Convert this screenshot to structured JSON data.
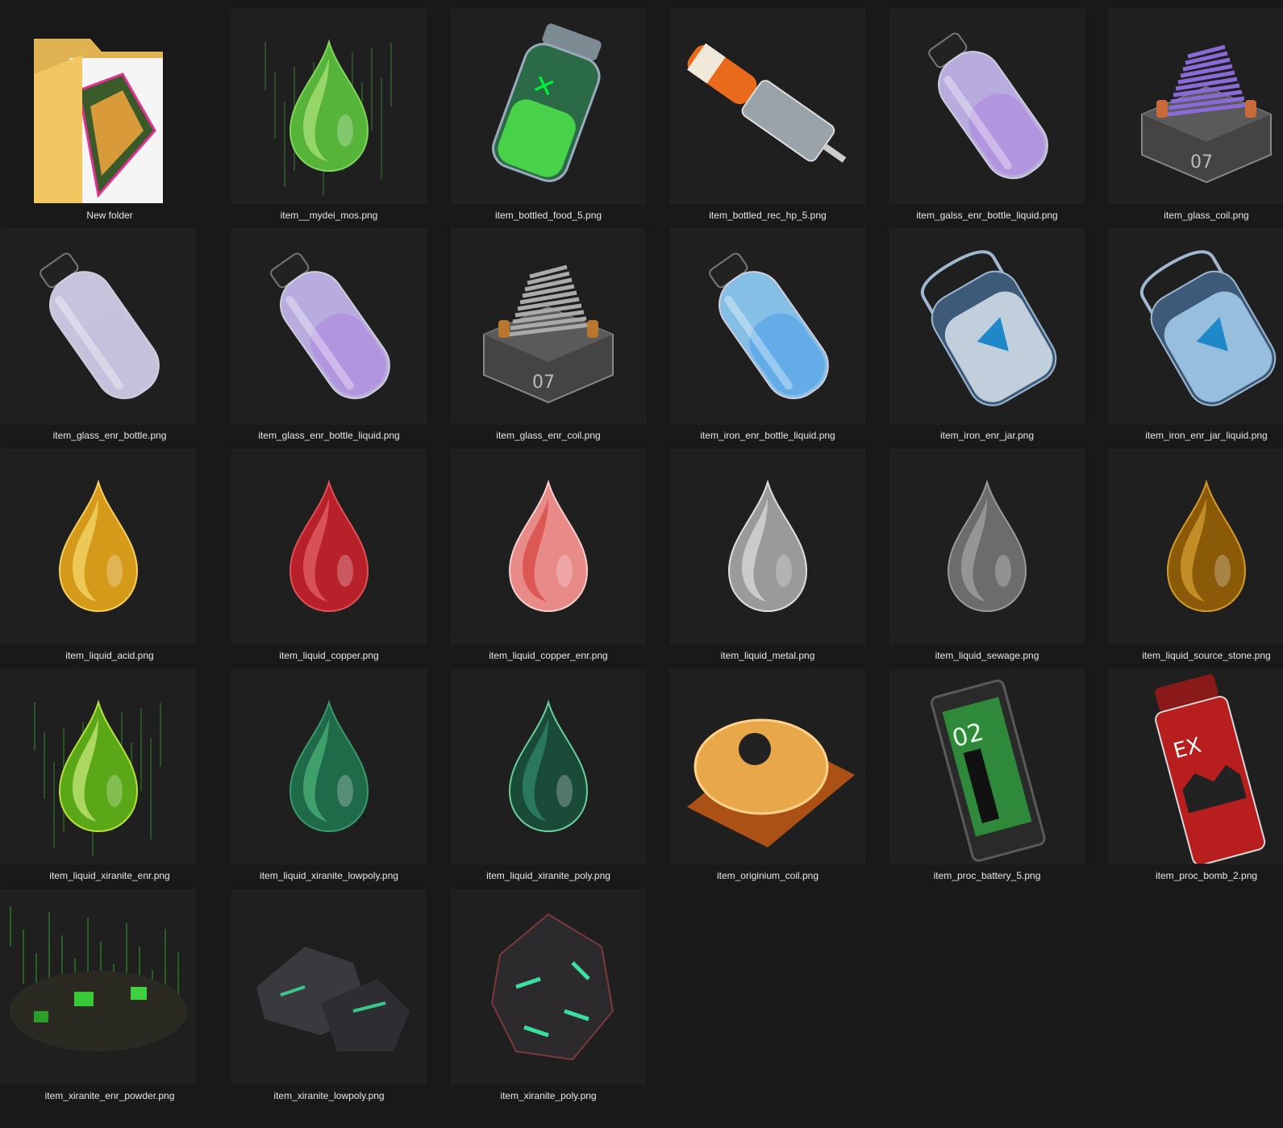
{
  "items": [
    {
      "label": "New folder",
      "icon": "folder-icon"
    },
    {
      "label": "item__mydei_mos.png",
      "icon": "green-droplet-icon"
    },
    {
      "label": "item_bottled_food_5.png",
      "icon": "green-canister-icon"
    },
    {
      "label": "item_bottled_rec_hp_5.png",
      "icon": "injector-icon"
    },
    {
      "label": "item_galss_enr_bottle_liquid.png",
      "icon": "purple-bottle-icon"
    },
    {
      "label": "item_glass_coil.png",
      "icon": "purple-coil-icon"
    },
    {
      "label": "item_glass_enr_bottle.png",
      "icon": "glass-bottle-icon"
    },
    {
      "label": "item_glass_enr_bottle_liquid.png",
      "icon": "purple-bottle-icon"
    },
    {
      "label": "item_glass_enr_coil.png",
      "icon": "grey-coil-icon"
    },
    {
      "label": "item_iron_enr_bottle_liquid.png",
      "icon": "blue-bottle-icon"
    },
    {
      "label": "item_iron_enr_jar.png",
      "icon": "blue-jar-icon"
    },
    {
      "label": "item_iron_enr_jar_liquid.png",
      "icon": "light-blue-jar-icon"
    },
    {
      "label": "item_liquid_acid.png",
      "icon": "gold-droplet-icon"
    },
    {
      "label": "item_liquid_copper.png",
      "icon": "red-droplet-icon"
    },
    {
      "label": "item_liquid_copper_enr.png",
      "icon": "pink-droplet-icon"
    },
    {
      "label": "item_liquid_metal.png",
      "icon": "silver-droplet-icon"
    },
    {
      "label": "item_liquid_sewage.png",
      "icon": "grey-droplet-icon"
    },
    {
      "label": "item_liquid_source_stone.png",
      "icon": "amber-droplet-icon"
    },
    {
      "label": "item_liquid_xiranite_enr.png",
      "icon": "bright-green-droplet-icon"
    },
    {
      "label": "item_liquid_xiranite_lowpoly.png",
      "icon": "teal-droplet-icon"
    },
    {
      "label": "item_liquid_xiranite_poly.png",
      "icon": "mint-droplet-icon"
    },
    {
      "label": "item_originium_coil.png",
      "icon": "orange-disc-icon"
    },
    {
      "label": "item_proc_battery_5.png",
      "icon": "battery-icon"
    },
    {
      "label": "item_proc_bomb_2.png",
      "icon": "grenade-icon"
    },
    {
      "label": "item_xiranite_enr_powder.png",
      "icon": "green-powder-icon"
    },
    {
      "label": "item_xiranite_lowpoly.png",
      "icon": "dark-rocks-icon"
    },
    {
      "label": "item_xiranite_poly.png",
      "icon": "ore-rock-icon"
    }
  ],
  "colors": {
    "background": "#191919",
    "thumb": "#1f1f1f",
    "label_text": "#e8e8e8"
  }
}
